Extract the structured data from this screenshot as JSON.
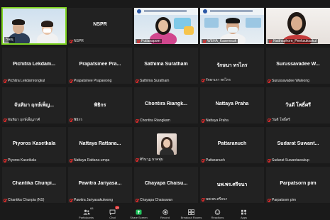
{
  "tiles": [
    {
      "label": "วิษณุ",
      "center": "",
      "video": true,
      "active": true,
      "muted": false
    },
    {
      "label": "NSPR",
      "center": "NSPR",
      "video": false,
      "active": false,
      "muted": true
    },
    {
      "label": "Putlanapom",
      "center": "",
      "video": true,
      "active": false,
      "muted": true
    },
    {
      "label": "WEHA_Kasemsuk",
      "center": "",
      "video": true,
      "active": false,
      "muted": true
    },
    {
      "label": "Natthaphorn_Peeksuksakul",
      "center": "",
      "video": true,
      "active": false,
      "muted": true
    },
    {
      "label": "Pichitra Lekdamrongkul",
      "center": "Pichitra Lekdam...",
      "video": false,
      "muted": true
    },
    {
      "label": "Prapatsinee Prapawong",
      "center": "Prapatsinee Pra...",
      "video": false,
      "muted": true
    },
    {
      "label": "Sathima Suratham",
      "center": "Sathima Suratham",
      "video": false,
      "muted": true
    },
    {
      "label": "รักษาเกา ทรไกร",
      "center": "รักษนา ทรไกร",
      "video": false,
      "muted": true
    },
    {
      "label": "Surussavadee Waleong",
      "center": "Surussavadee W...",
      "video": false,
      "muted": true
    },
    {
      "label": "จันทิมา ฤกษ์เพ็ญภาคี",
      "center": "จันทิมา ฤกษ์เพ็ญ...",
      "video": false,
      "muted": true
    },
    {
      "label": "พิธิกร",
      "center": "พิธิกร",
      "video": false,
      "muted": true
    },
    {
      "label": "Chontira Riangkam",
      "center": "Chontira Riangk...",
      "video": false,
      "muted": true
    },
    {
      "label": "Nattaya Praha",
      "center": "Nattaya Praha",
      "video": false,
      "muted": true
    },
    {
      "label": "วันดี โพธิ์ศรี",
      "center": "วันดี โพธิ์ศรี",
      "video": false,
      "muted": true
    },
    {
      "label": "Piyoros Kasetkala",
      "center": "Piyoros Kasetkala",
      "video": false,
      "muted": true
    },
    {
      "label": "Nattaya Rattana-umpa",
      "center": "Nattaya Rattana...",
      "video": false,
      "muted": true
    },
    {
      "label": "ศิรินาฏ นาคพุ่ม",
      "center": "",
      "video": false,
      "avatar": true,
      "muted": true
    },
    {
      "label": "Pattaranuch",
      "center": "Pattaranuch",
      "video": false,
      "muted": true
    },
    {
      "label": "Sudarat Suwantawakup",
      "center": "Sudarat Suwant...",
      "video": false,
      "muted": true
    },
    {
      "label": "Chantika Chunpia (NS)",
      "center": "Chantika Chunpi...",
      "video": false,
      "muted": true
    },
    {
      "label": "Pawitra Jariyasakulwong",
      "center": "Pawitra Jariyasa...",
      "video": false,
      "muted": true
    },
    {
      "label": "Chayapa Chaisuwan",
      "center": "Chayapa Chaisu...",
      "video": false,
      "muted": true
    },
    {
      "label": "นพ.พร.ศรีจนา",
      "center": "นพ.พร.ศรีจนา",
      "video": false,
      "muted": true
    },
    {
      "label": "Parpatsorn pim",
      "center": "Parpatsorn pim",
      "video": false,
      "muted": true
    }
  ],
  "toolbar": {
    "participants_label": "Participants",
    "participants_count": "68",
    "chat_label": "Chat",
    "chat_badge": "19",
    "share_label": "Share Screen",
    "record_label": "Record",
    "breakout_label": "Breakout Rooms",
    "reactions_label": "Reactions",
    "apps_label": "Apps"
  },
  "colors": {
    "background": "#1a1a1a",
    "tile": "#222222",
    "active_speaker_border": "#7ed321",
    "share_green": "#22c55e",
    "muted_red": "#e02b2b"
  }
}
